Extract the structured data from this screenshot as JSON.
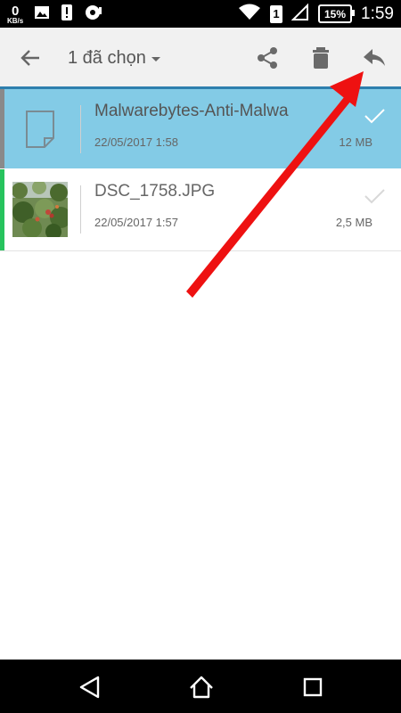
{
  "status_bar": {
    "speed_value": "0",
    "speed_unit": "KB/s",
    "sim_number": "1",
    "battery_percent": "15%",
    "time": "1:59",
    "icons": [
      "gallery-icon",
      "alert-icon",
      "sync-icon",
      "wifi-icon",
      "sim-icon",
      "signal-icon",
      "battery-icon"
    ]
  },
  "app_bar": {
    "selection_title": "1 đã chọn",
    "actions": [
      "back-arrow-icon",
      "share-icon",
      "delete-icon",
      "reply-icon"
    ]
  },
  "files": [
    {
      "name": "Malwarebytes-Anti-Malwa",
      "date": "22/05/2017 1:58",
      "size": "12 MB",
      "selected": true,
      "thumb": "document-icon"
    },
    {
      "name": "DSC_1758.JPG",
      "date": "22/05/2017 1:57",
      "size": "2,5 MB",
      "selected": false,
      "thumb": "photo-thumbnail"
    }
  ],
  "colors": {
    "selected_row": "#83cbe6",
    "selection_bar": "#2e7fae",
    "image_accent": "#27c35d",
    "annotation_arrow": "#ee1111"
  },
  "nav_bar": [
    "nav-back-icon",
    "nav-home-icon",
    "nav-recent-icon"
  ]
}
